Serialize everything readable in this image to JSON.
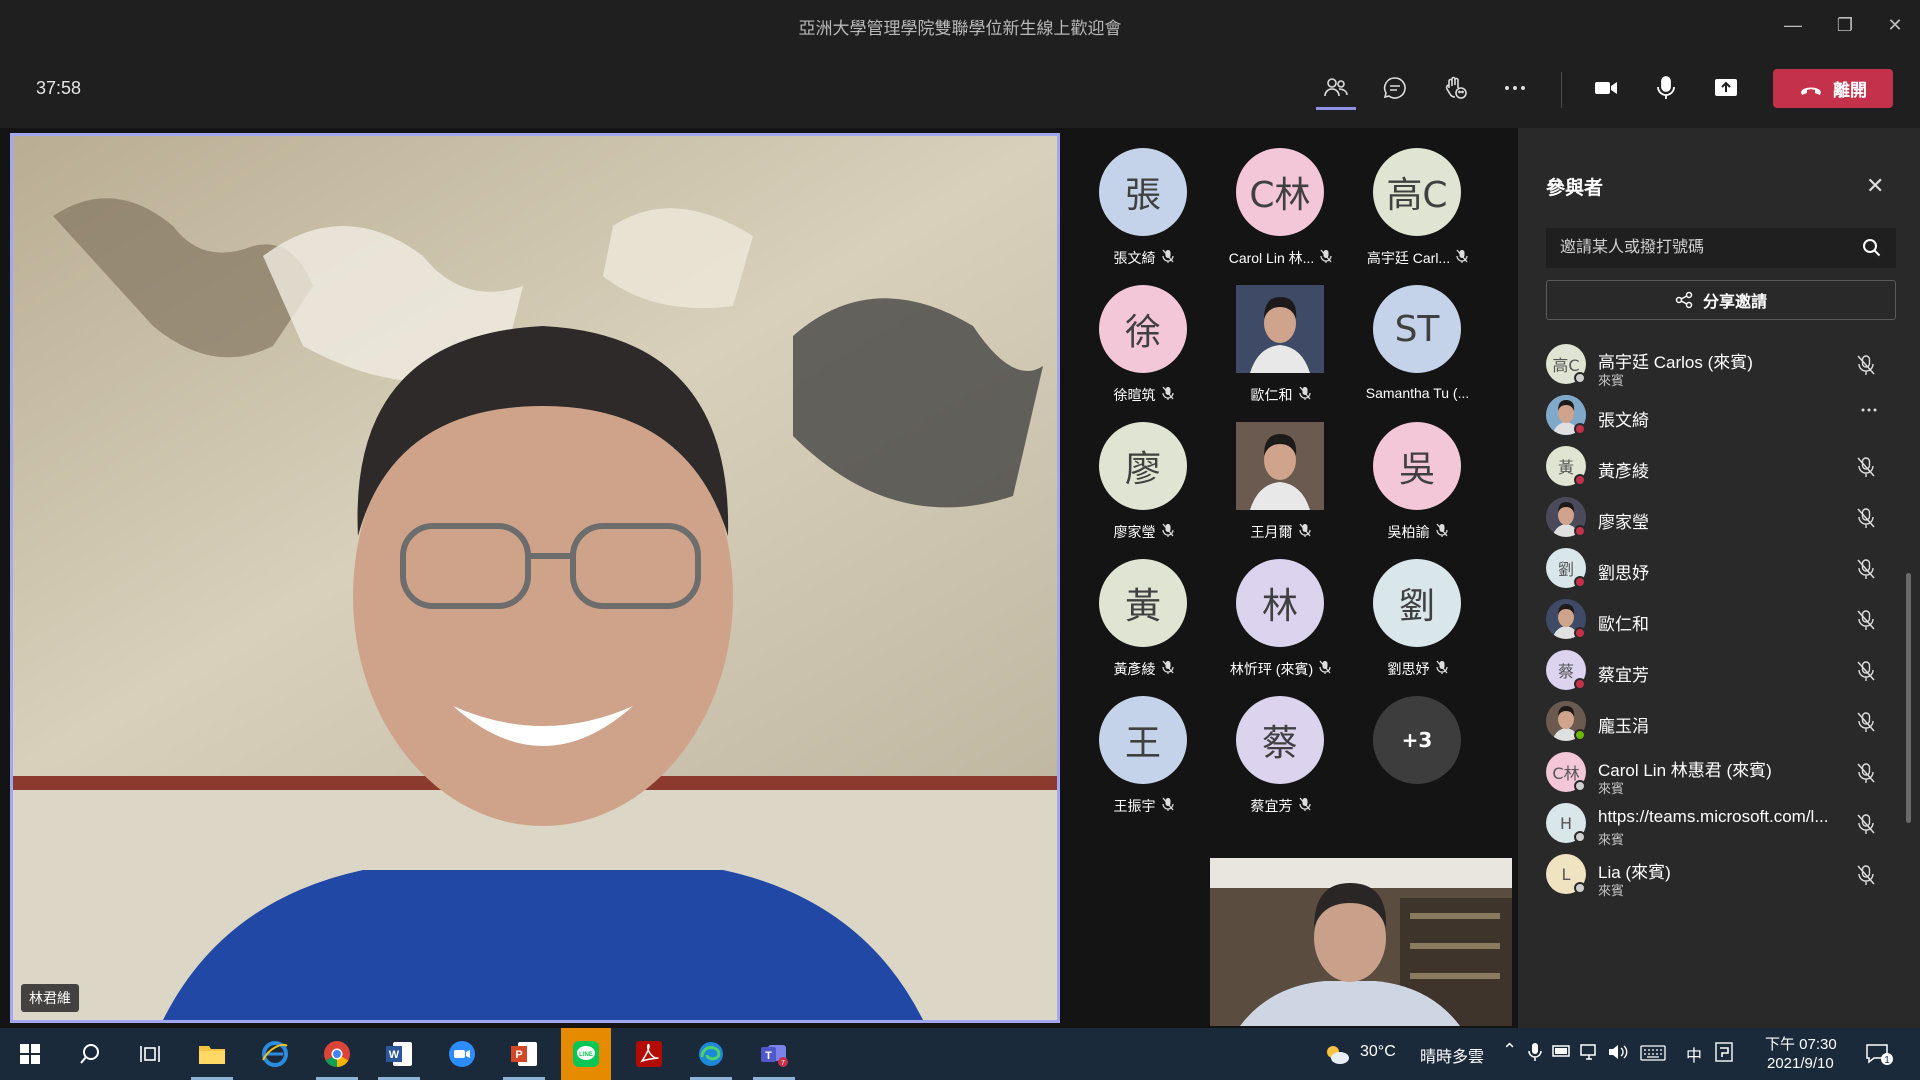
{
  "window": {
    "title": "亞洲大學管理學院雙聯學位新生線上歡迎會",
    "minimize_glyph": "—",
    "restore_glyph": "❐",
    "close_glyph": "✕"
  },
  "toolbar": {
    "timer": "37:58",
    "leave_label": "離開",
    "icons": [
      "people-icon",
      "chat-icon",
      "reactions-icon",
      "more-icon",
      "camera-icon",
      "mic-icon",
      "share-screen-icon"
    ]
  },
  "main_video": {
    "speaker_name": "林君維"
  },
  "roster": [
    {
      "initials": "張",
      "label": "張文綺",
      "color": "#c5d3ea",
      "muted": true,
      "photo": false
    },
    {
      "initials": "C林",
      "label": "Carol Lin 林...",
      "color": "#f3c6d8",
      "muted": true,
      "photo": false
    },
    {
      "initials": "高C",
      "label": "高宇廷 Carl...",
      "color": "#dfe5d2",
      "muted": true,
      "photo": false
    },
    {
      "initials": "徐",
      "label": "徐暄筑",
      "color": "#f3c6d8",
      "muted": true,
      "photo": false
    },
    {
      "initials": "",
      "label": "歐仁和",
      "color": "#3e4a66",
      "muted": true,
      "photo": true
    },
    {
      "initials": "ST",
      "label": "Samantha Tu (...",
      "color": "#c5d3ea",
      "muted": false,
      "photo": false
    },
    {
      "initials": "廖",
      "label": "廖家瑩",
      "color": "#dfe5d2",
      "muted": true,
      "photo": false
    },
    {
      "initials": "",
      "label": "王月爾",
      "color": "#6a5a50",
      "muted": true,
      "photo": true
    },
    {
      "initials": "吳",
      "label": "吳柏諭",
      "color": "#f3c6d8",
      "muted": true,
      "photo": false
    },
    {
      "initials": "黃",
      "label": "黃彥綾",
      "color": "#dfe5d2",
      "muted": true,
      "photo": false
    },
    {
      "initials": "林",
      "label": "林忻玶 (來賓)",
      "color": "#dcd3ef",
      "muted": true,
      "photo": false
    },
    {
      "initials": "劉",
      "label": "劉思妤",
      "color": "#d9e6ea",
      "muted": true,
      "photo": false
    },
    {
      "initials": "王",
      "label": "王振宇",
      "color": "#c5d3ea",
      "muted": true,
      "photo": false
    },
    {
      "initials": "蔡",
      "label": "蔡宜芳",
      "color": "#dcd3ef",
      "muted": true,
      "photo": false
    },
    {
      "initials": "+3",
      "label": "",
      "color": "#3d3d3d",
      "muted": false,
      "photo": false
    }
  ],
  "panel": {
    "title": "參與者",
    "invite_placeholder": "邀請某人或撥打號碼",
    "share_label": "分享邀請",
    "participants": [
      {
        "name": "高宇廷 Carlos (來賓)",
        "sub": "來賓",
        "initials": "高C",
        "color": "#dfe5d2",
        "status": "#d0d0d0",
        "action": "mic-off"
      },
      {
        "name": "張文綺",
        "sub": "",
        "initials": "",
        "color": "#7fa8c9",
        "status": "#c4314b",
        "action": "more"
      },
      {
        "name": "黃彥綾",
        "sub": "",
        "initials": "黃",
        "color": "#dfe5d2",
        "status": "#c4314b",
        "action": "mic-off"
      },
      {
        "name": "廖家瑩",
        "sub": "",
        "initials": "",
        "color": "#4a4a5a",
        "status": "#c4314b",
        "action": "mic-off"
      },
      {
        "name": "劉思妤",
        "sub": "",
        "initials": "劉",
        "color": "#d9e6ea",
        "status": "#c4314b",
        "action": "mic-off"
      },
      {
        "name": "歐仁和",
        "sub": "",
        "initials": "",
        "color": "#3e4a66",
        "status": "#c4314b",
        "action": "mic-off"
      },
      {
        "name": "蔡宜芳",
        "sub": "",
        "initials": "蔡",
        "color": "#dcd3ef",
        "status": "#c4314b",
        "action": "mic-off"
      },
      {
        "name": "龐玉涓",
        "sub": "",
        "initials": "",
        "color": "#6a5a50",
        "status": "#6bb700",
        "action": "mic-off"
      },
      {
        "name": "Carol Lin 林惠君 (來賓)",
        "sub": "來賓",
        "initials": "C林",
        "color": "#f3c6d8",
        "status": "#d0d0d0",
        "action": "mic-off"
      },
      {
        "name": "https://teams.microsoft.com/l...",
        "sub": "來賓",
        "initials": "H",
        "color": "#d9e6ea",
        "status": "#d0d0d0",
        "action": "mic-off"
      },
      {
        "name": "Lia (來賓)",
        "sub": "來賓",
        "initials": "L",
        "color": "#f0e3c2",
        "status": "#d0d0d0",
        "action": "mic-off"
      }
    ]
  },
  "taskbar": {
    "apps": [
      "start-icon",
      "search-icon",
      "task-view-icon",
      "file-explorer-icon",
      "ie-icon",
      "chrome-icon",
      "word-icon",
      "zoom-icon",
      "powerpoint-icon",
      "line-icon",
      "acrobat-icon",
      "edge-icon",
      "teams-icon"
    ],
    "weather_temp": "30°C",
    "weather_desc": "晴時多雲",
    "ime": "中",
    "time": "下午 07:30",
    "date": "2021/9/10",
    "notification_count": "1"
  }
}
